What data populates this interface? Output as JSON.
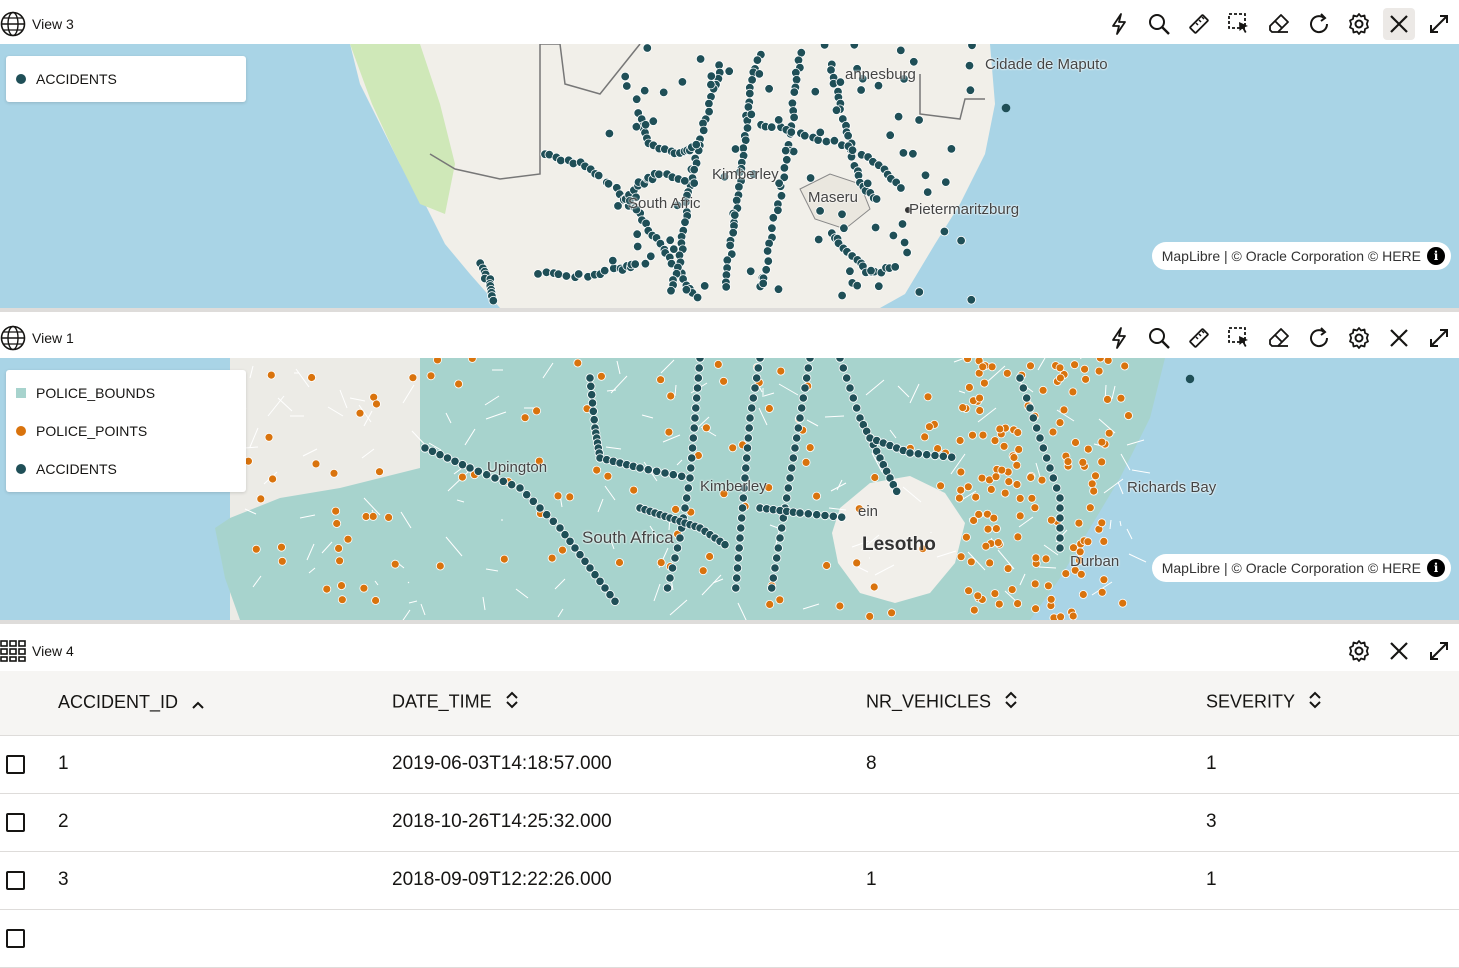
{
  "view3": {
    "title": "View 3",
    "legend": [
      {
        "label": "ACCIDENTS",
        "color": "#1f4f57"
      }
    ],
    "cities": [
      "Cidade de Maputo",
      "annesburg",
      "Kimberley",
      "South Afric",
      "Maseru",
      "Pietermaritzburg"
    ],
    "attribution": "MapLibre | © Oracle Corporation  © HERE"
  },
  "view1": {
    "title": "View 1",
    "legend": [
      {
        "label": "POLICE_BOUNDS",
        "color": "#a7d3cd"
      },
      {
        "label": "POLICE_POINTS",
        "color": "#d9730d"
      },
      {
        "label": "ACCIDENTS",
        "color": "#1f4f57"
      }
    ],
    "cities": [
      "Richards Bay",
      "Lesotho",
      "Durban",
      "Kimberley",
      "South Africa",
      "Upington",
      "ein"
    ],
    "attribution": "MapLibre | © Oracle Corporation  © HERE"
  },
  "view4": {
    "title": "View 4",
    "columns": [
      "ACCIDENT_ID",
      "DATE_TIME",
      "NR_VEHICLES",
      "SEVERITY"
    ],
    "rows": [
      {
        "id": "1",
        "date_time": "2019-06-03T14:18:57.000",
        "nr_vehicles": "8",
        "severity": "1"
      },
      {
        "id": "2",
        "date_time": "2018-10-26T14:25:32.000",
        "nr_vehicles": "",
        "severity": "3"
      },
      {
        "id": "3",
        "date_time": "2018-09-09T12:22:26.000",
        "nr_vehicles": "1",
        "severity": "1"
      }
    ]
  },
  "toolbar_icons": [
    "lightning-icon",
    "search-icon",
    "ruler-icon",
    "select-region-icon",
    "eraser-icon",
    "refresh-icon",
    "gear-icon",
    "close-icon",
    "expand-icon"
  ],
  "colors": {
    "accidents": "#1f4f57",
    "police_points": "#d9730d",
    "police_bounds": "#a7d3cd",
    "water": "#a9d4e6",
    "land": "#f1efe9"
  }
}
